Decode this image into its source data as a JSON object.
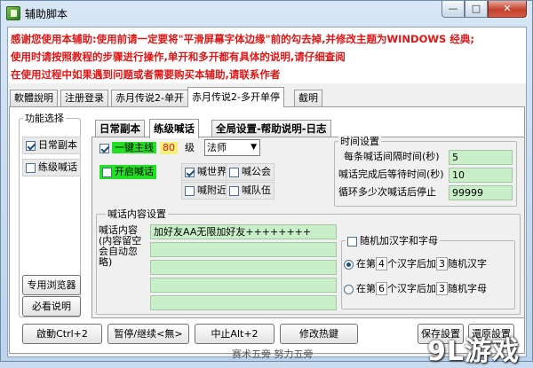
{
  "window": {
    "title": "辅助脚本",
    "minimize_glyph": "—",
    "maximize_glyph": "□",
    "close_glyph": "✕"
  },
  "notice": {
    "line1": "感谢您使用本辅助:使用前请一定要将\"平滑屏幕字体边缘\"前的勾去掉,并修改主题为WINDOWS 经典;",
    "line2": "使用时请按照教程的步骤进行操作,单开和多开都有具体的说明,请仔细查阅",
    "line3": "在使用过程中如果遇到问题或者需要购买本辅助,请联系作者"
  },
  "tabs": [
    {
      "label": "軟體說明"
    },
    {
      "label": "注册登录"
    },
    {
      "label": "赤月传说2-单开"
    },
    {
      "label": "赤月传说2-多开单停"
    },
    {
      "label": "截明"
    }
  ],
  "func_group": {
    "title": "功能选择",
    "opt_daily": "日常副本",
    "opt_shout": "练级喊话",
    "browser_button": "专用浏览器",
    "must_read_button": "必看说明"
  },
  "inner_tabs": [
    {
      "label": "日常副本"
    },
    {
      "label": "练级喊话"
    },
    {
      "label": "全局设置-帮助说明-日志"
    }
  ],
  "level": {
    "one_key_label": "一键主线",
    "level_value": "80",
    "level_unit": "级",
    "class_value": "法师"
  },
  "shout": {
    "open_label": "开启喊话",
    "world": "喊世界",
    "guild": "喊公会",
    "nearby": "喊附近",
    "team": "喊队伍"
  },
  "timing": {
    "title": "时间设置",
    "interval_label": "每条喊话间隔时间(秒)",
    "interval_value": "5",
    "wait_label": "喊话完成后等待时间(秒)",
    "wait_value": "10",
    "loop_label": "循环多少次喊话后停止",
    "loop_value": "99999"
  },
  "content": {
    "title": "喊话内容设置",
    "label": "喊话内容(内容留空会自动忽略)",
    "line1": "加好友AA无限加好友++++++++",
    "line2": "",
    "line3": "",
    "line4": "",
    "line5": ""
  },
  "random": {
    "checkbox_label": "随机加汉字和字母",
    "opt1_pre": "在第",
    "opt1_n": "4",
    "opt1_mid": "个汉字后加",
    "opt1_m": "3",
    "opt1_post": "随机汉字",
    "opt2_pre": "在第",
    "opt2_n": "6",
    "opt2_mid": "个汉字后加",
    "opt2_m": "3",
    "opt2_post": "随机字母"
  },
  "bottom": {
    "start": "啟動Ctrl+2",
    "pause": "暂停/继续<無>",
    "stop": "中止Alt+2",
    "hotkey": "修改热鍵",
    "save": "保存設置",
    "restore": "還原設置"
  },
  "footer_text": "赛术五旁  努力五旁",
  "watermark": "9L游戏"
}
